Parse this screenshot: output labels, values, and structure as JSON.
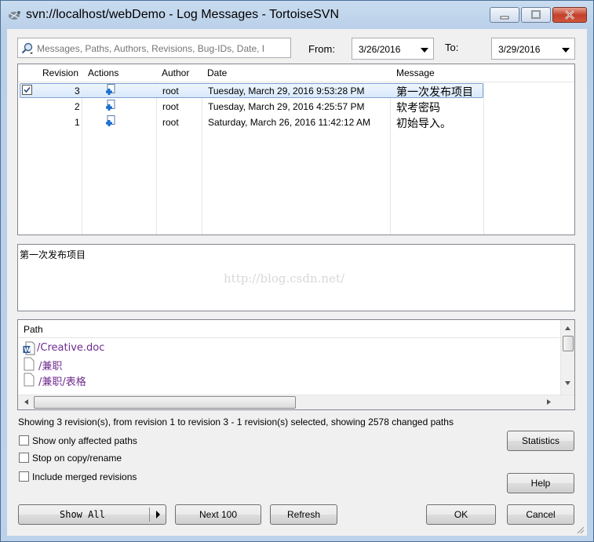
{
  "window": {
    "title": "svn://localhost/webDemo - Log Messages - TortoiseSVN"
  },
  "filter": {
    "search_placeholder": "Messages, Paths, Authors, Revisions, Bug-IDs, Date, I",
    "from_label": "From:",
    "from_value": "3/26/2016",
    "to_label": "To:",
    "to_value": "3/29/2016"
  },
  "log": {
    "columns": [
      "Revision",
      "Actions",
      "Author",
      "Date",
      "Message"
    ],
    "rows": [
      {
        "revision": "3",
        "author": "root",
        "date": "Tuesday, March 29, 2016 9:53:28 PM",
        "message": "第一次发布项目",
        "selected": true
      },
      {
        "revision": "2",
        "author": "root",
        "date": "Tuesday, March 29, 2016 4:25:57 PM",
        "message": "软考密码",
        "selected": false
      },
      {
        "revision": "1",
        "author": "root",
        "date": "Saturday, March 26, 2016 11:42:12 AM",
        "message": "初始导入。",
        "selected": false
      }
    ]
  },
  "message_box": {
    "text": "第一次发布项目",
    "watermark": "http://blog.csdn.net/"
  },
  "paths": {
    "header": "Path",
    "items": [
      "/Creative.doc",
      "/兼职",
      "/兼职/表格"
    ]
  },
  "status": {
    "text": "Showing 3 revision(s), from revision 1 to revision 3 - 1 revision(s) selected, showing 2578 changed paths"
  },
  "options": {
    "show_affected": "Show only affected paths",
    "stop_on_copy": "Stop on copy/rename",
    "include_merged": "Include merged revisions"
  },
  "buttons": {
    "statistics": "Statistics",
    "help": "Help",
    "show_all": "Show All",
    "next_100": "Next 100",
    "refresh": "Refresh",
    "ok": "OK",
    "cancel": "Cancel"
  },
  "colors": {
    "path_text": "#6d2b8e",
    "selection_border": "#7da2ce",
    "close_button": "#c3412b"
  }
}
